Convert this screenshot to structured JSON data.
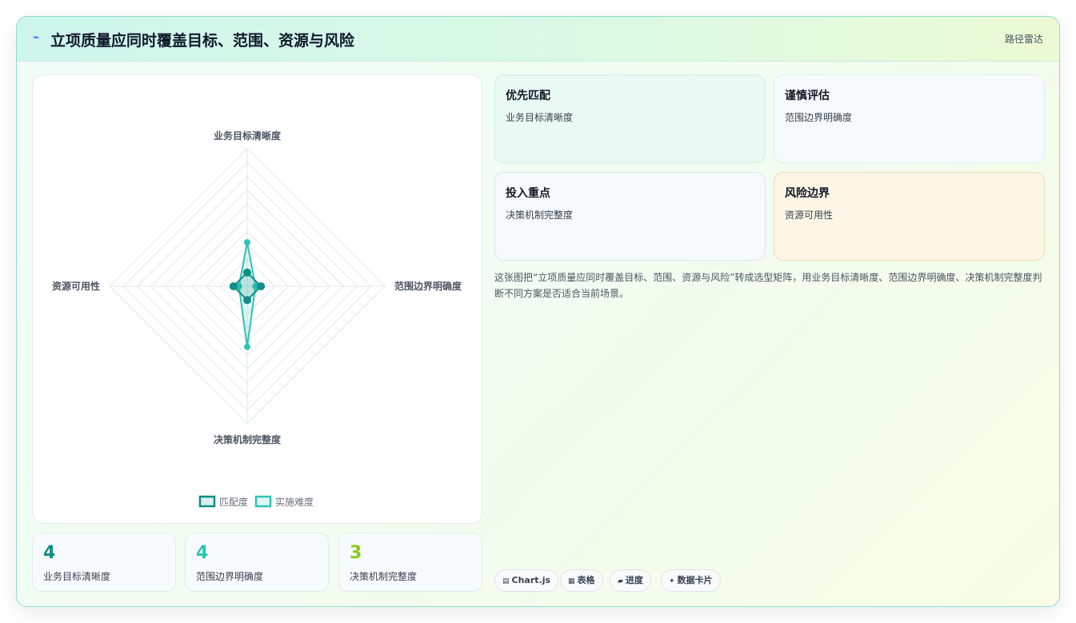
{
  "header": {
    "title": "立项质量应同时覆盖目标、范围、资源与风险",
    "mode": "路径雷达"
  },
  "chart_data": {
    "type": "radar",
    "axes": [
      "业务目标清晰度",
      "范围边界明确度",
      "决策机制完整度",
      "资源可用性"
    ],
    "max": 5,
    "rings": 10,
    "grid": true,
    "legend": "bottom",
    "series": [
      {
        "name": "匹配度",
        "values": [
          0.5,
          0.5,
          0.5,
          0.5
        ],
        "color": "#0f8f86",
        "fill": "rgba(15,143,134,0.18)"
      },
      {
        "name": "实施难度",
        "values": [
          1.6,
          0.3,
          2.2,
          0.3
        ],
        "color": "#2ec4b6",
        "fill": "rgba(46,196,182,0.15)"
      }
    ]
  },
  "kpis": [
    {
      "value": "4",
      "label": "业务目标清晰度",
      "color": "#0f8f86"
    },
    {
      "value": "4",
      "label": "范围边界明确度",
      "color": "#2ec4b6"
    },
    {
      "value": "3",
      "label": "决策机制完整度",
      "color": "#84cc16"
    }
  ],
  "cards": [
    {
      "title": "优先匹配",
      "text": "业务目标清晰度"
    },
    {
      "title": "谨慎评估",
      "text": "范围边界明确度"
    },
    {
      "title": "投入重点",
      "text": "决策机制完整度"
    },
    {
      "title": "风险边界",
      "text": "资源可用性"
    }
  ],
  "description": "这张图把“立项质量应同时覆盖目标、范围、资源与风险”转成选型矩阵，用业务目标清晰度、范围边界明确度、决策机制完整度判断不同方案是否适合当前场景。",
  "tags": [
    {
      "icon": "▤",
      "label": "Chart.js"
    },
    {
      "icon": "▦",
      "label": "表格"
    },
    {
      "icon": "▰",
      "label": "进度"
    },
    {
      "icon": "✦",
      "label": "数据卡片"
    }
  ]
}
